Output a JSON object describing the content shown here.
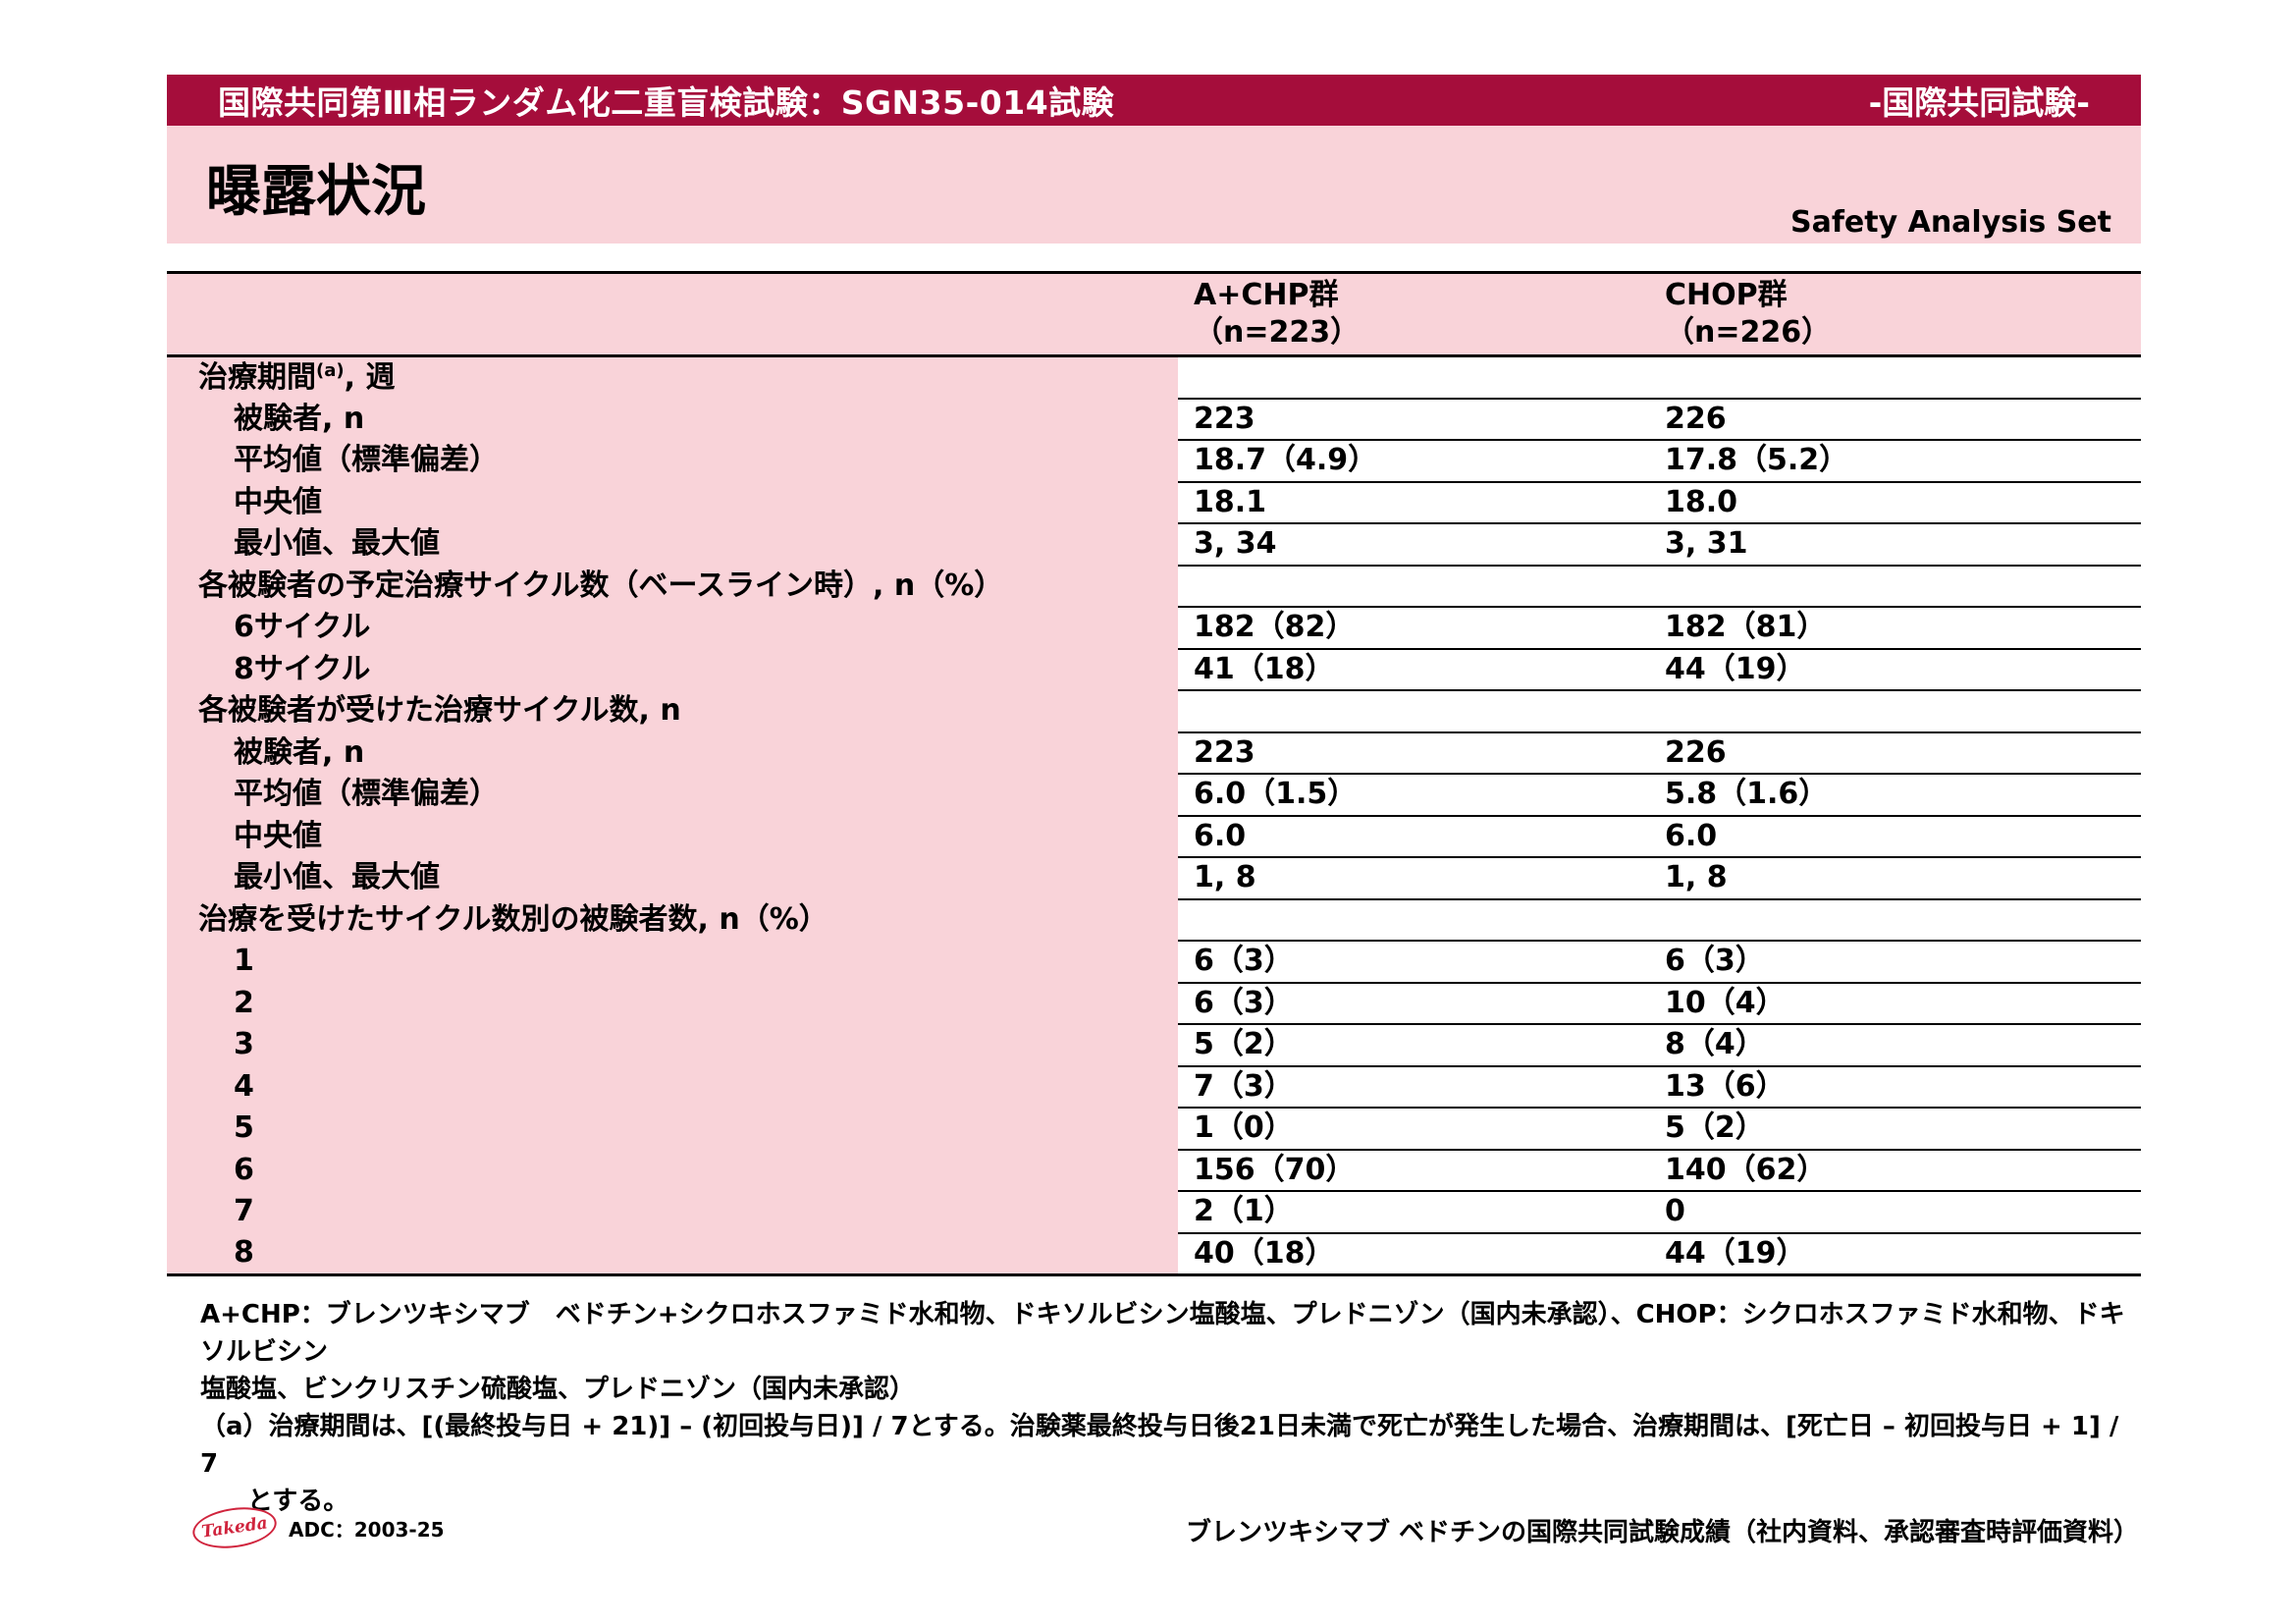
{
  "header": {
    "title": "国際共同第Ⅲ相ランダム化二重盲検試験：SGN35-014試験",
    "tag": "-国際共同試験-"
  },
  "page": {
    "title": "曝露状況",
    "analysis_set": "Safety Analysis Set"
  },
  "table": {
    "col1_head_l1": "A+CHP群",
    "col1_head_l2": "（n=223）",
    "col2_head_l1": "CHOP群",
    "col2_head_l2": "（n=226）",
    "rows": [
      {
        "label": "治療期間",
        "sup": "(a)",
        "suffix": ", 週",
        "a": "",
        "b": ""
      },
      {
        "label": "被験者, n",
        "a": "223",
        "b": "226"
      },
      {
        "label": "平均値（標準偏差）",
        "a": "18.7（4.9）",
        "b": "17.8（5.2）"
      },
      {
        "label": "中央値",
        "a": "18.1",
        "b": "18.0"
      },
      {
        "label": "最小値、最大値",
        "a": "3, 34",
        "b": "3, 31"
      },
      {
        "label": "各被験者の予定治療サイクル数（ベースライン時）, n（%）",
        "a": "",
        "b": ""
      },
      {
        "label": "6サイクル",
        "a": "182（82）",
        "b": "182（81）"
      },
      {
        "label": "8サイクル",
        "a": "41（18）",
        "b": "44（19）"
      },
      {
        "label": "各被験者が受けた治療サイクル数, n",
        "a": "",
        "b": ""
      },
      {
        "label": "被験者, n",
        "a": "223",
        "b": "226"
      },
      {
        "label": "平均値（標準偏差）",
        "a": "6.0（1.5）",
        "b": "5.8（1.6）"
      },
      {
        "label": "中央値",
        "a": "6.0",
        "b": "6.0"
      },
      {
        "label": "最小値、最大値",
        "a": "1, 8",
        "b": "1, 8"
      },
      {
        "label": "治療を受けたサイクル数別の被験者数, n（%）",
        "a": "",
        "b": ""
      },
      {
        "label": "1",
        "a": "6（3）",
        "b": "6（3）"
      },
      {
        "label": "2",
        "a": "6（3）",
        "b": "10（4）"
      },
      {
        "label": "3",
        "a": "5（2）",
        "b": "8（4）"
      },
      {
        "label": "4",
        "a": "7（3）",
        "b": "13（6）"
      },
      {
        "label": "5",
        "a": "1（0）",
        "b": "5（2）"
      },
      {
        "label": "6",
        "a": "156（70）",
        "b": "140（62）"
      },
      {
        "label": "7",
        "a": "2（1）",
        "b": "0"
      },
      {
        "label": "8",
        "a": "40（18）",
        "b": "44（19）"
      }
    ]
  },
  "notes": {
    "line1": "A+CHP：ブレンツキシマブ　ベドチン+シクロホスファミド水和物、ドキソルビシン塩酸塩、プレドニゾン（国内未承認）、CHOP：シクロホスファミド水和物、ドキソルビシン",
    "line2": "塩酸塩、ビンクリスチン硫酸塩、プレドニゾン（国内未承認）",
    "line3": "（a）治療期間は、[(最終投与日 + 21)] – (初回投与日)] / 7とする。治験薬最終投与日後21日未満で死亡が発生した場合、治療期間は、[死亡日 – 初回投与日 + 1] / 7",
    "line4": "とする。"
  },
  "footer": {
    "logo_text": "Takeda",
    "code": "ADC：2003-25",
    "source": "ブレンツキシマブ ベドチンの国際共同試験成績（社内資料、承認審査時評価資料）"
  },
  "colors": {
    "header_bg": "#a50d3b",
    "pink_bg": "#f9d3d9",
    "logo_red": "#d0243d"
  }
}
